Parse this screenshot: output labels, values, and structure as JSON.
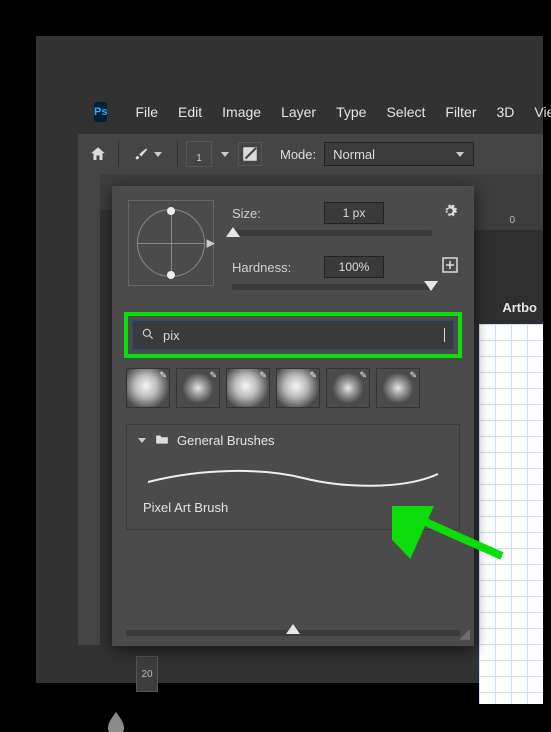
{
  "app": {
    "logo": "Ps"
  },
  "menu": [
    "File",
    "Edit",
    "Image",
    "Layer",
    "Type",
    "Select",
    "Filter",
    "3D",
    "View"
  ],
  "options": {
    "brush_size_num": "1",
    "mode_label": "Mode:",
    "mode_value": "Normal"
  },
  "brush_panel": {
    "size_label": "Size:",
    "size_value": "1 px",
    "hardness_label": "Hardness:",
    "hardness_value": "100%",
    "search_value": "pix",
    "group_title": "General Brushes",
    "brush_name": "Pixel Art Brush"
  },
  "canvas": {
    "ruler_tick": "0",
    "artboard_label": "Artbo",
    "side_num": "20"
  }
}
